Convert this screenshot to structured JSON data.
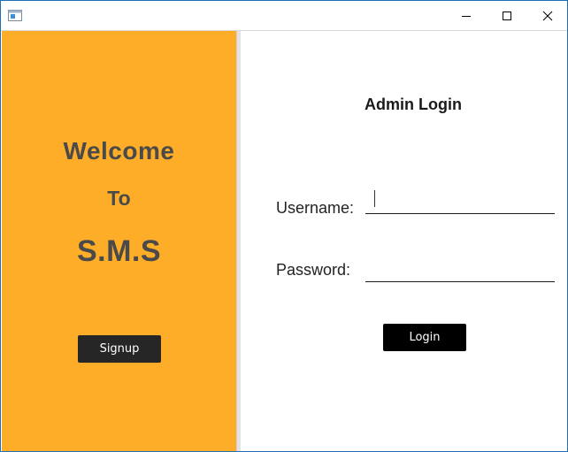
{
  "window": {
    "title": "",
    "controls": [
      "minimize-icon",
      "maximize-icon",
      "close-icon"
    ]
  },
  "welcome_panel": {
    "line1": "Welcome",
    "line2": "To",
    "line3": "S.M.S",
    "signup_label": "Signup",
    "background": "#fdad27",
    "text_color": "#4a4a4a"
  },
  "login_panel": {
    "title": "Admin Login",
    "username_label": "Username:",
    "username_value": "",
    "password_label": "Password:",
    "password_value": "",
    "login_label": "Login"
  },
  "colors": {
    "button_dark": "#262626",
    "button_black": "#000000"
  }
}
